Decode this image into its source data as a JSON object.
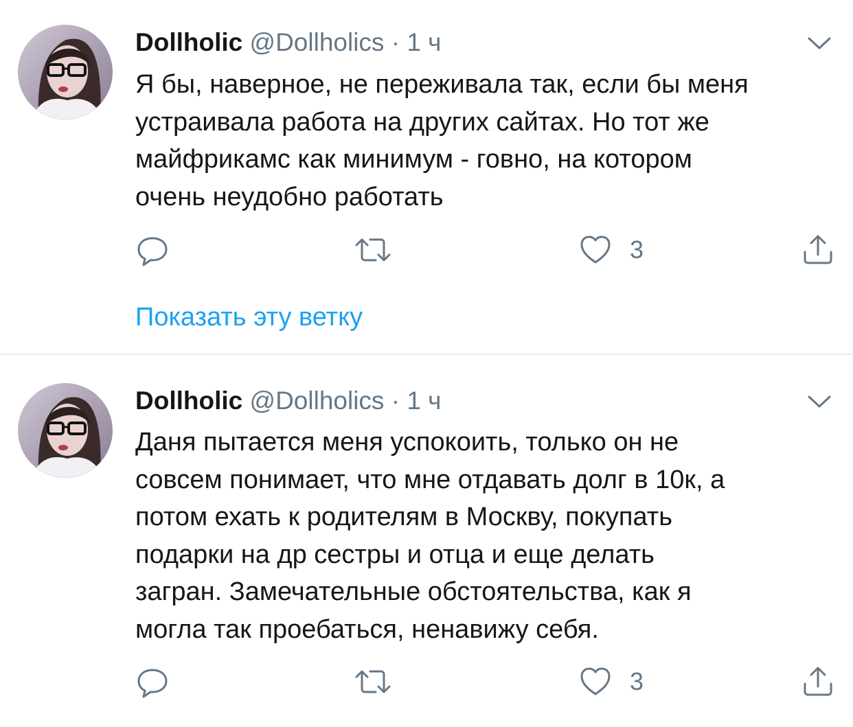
{
  "colors": {
    "text": "#14171a",
    "secondary": "#657786",
    "link": "#1da1f2",
    "divider": "#e6ecf0"
  },
  "tweets": [
    {
      "author": {
        "name": "Dollholic",
        "handle": "@Dollholics"
      },
      "separator": "·",
      "time": "1 ч",
      "text": "Я бы, наверное, не переживала так, если бы меня\nустраивала работа на других сайтах. Но тот же\nмайфрикамс как минимум - говно, на котором\nочень неудобно работать",
      "actions": {
        "reply": {
          "icon": "reply-icon"
        },
        "retweet": {
          "icon": "retweet-icon"
        },
        "like": {
          "icon": "heart-icon",
          "count": "3"
        },
        "share": {
          "icon": "share-icon"
        }
      },
      "show_thread": "Показать эту ветку"
    },
    {
      "author": {
        "name": "Dollholic",
        "handle": "@Dollholics"
      },
      "separator": "·",
      "time": "1 ч",
      "text": "Даня пытается меня успокоить,  только он не\nсовсем понимает,  что мне отдавать долг в 10к, а\nпотом ехать к родителям в Москву, покупать\nподарки на др сестры и отца и еще делать\nзагран. Замечательные обстоятельства, как я\nмогла так проебаться, ненавижу себя.",
      "actions": {
        "reply": {
          "icon": "reply-icon"
        },
        "retweet": {
          "icon": "retweet-icon"
        },
        "like": {
          "icon": "heart-icon",
          "count": "3"
        },
        "share": {
          "icon": "share-icon"
        }
      }
    }
  ]
}
